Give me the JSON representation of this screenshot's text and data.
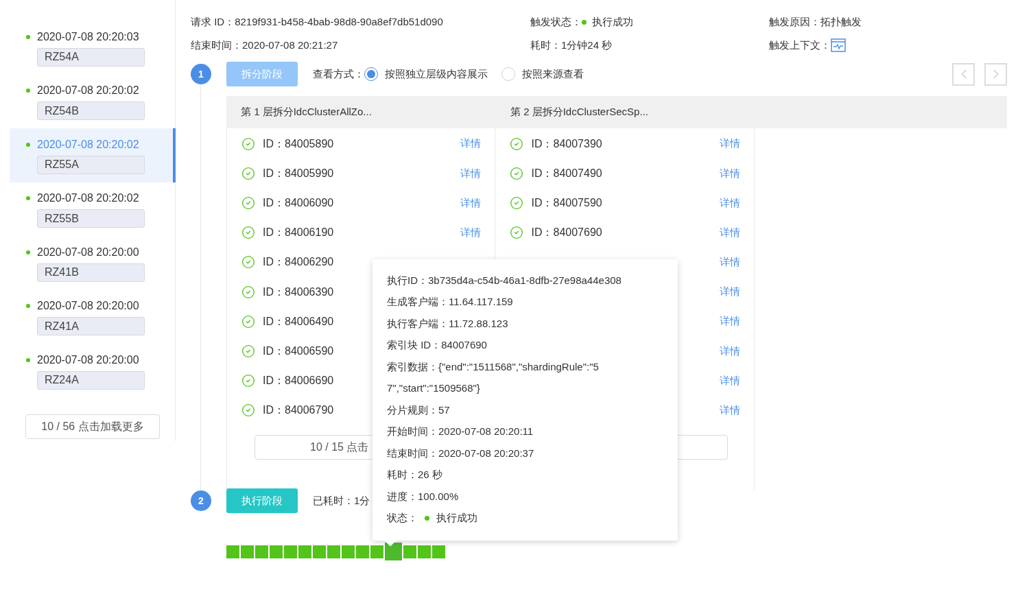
{
  "sidebar": {
    "items": [
      {
        "time": "2020-07-08 20:20:03",
        "tag": "RZ54A",
        "selected": false
      },
      {
        "time": "2020-07-08 20:20:02",
        "tag": "RZ54B",
        "selected": false
      },
      {
        "time": "2020-07-08 20:20:02",
        "tag": "RZ55A",
        "selected": true
      },
      {
        "time": "2020-07-08 20:20:02",
        "tag": "RZ55B",
        "selected": false
      },
      {
        "time": "2020-07-08 20:20:00",
        "tag": "RZ41B",
        "selected": false
      },
      {
        "time": "2020-07-08 20:20:00",
        "tag": "RZ41A",
        "selected": false
      },
      {
        "time": "2020-07-08 20:20:00",
        "tag": "RZ24A",
        "selected": false
      }
    ],
    "load_more": "10 / 56 点击加载更多"
  },
  "summary": [
    {
      "kind": "text",
      "label": "请求 ID：",
      "value": "8219f931-b458-4bab-98d8-90a8ef7db51d090"
    },
    {
      "kind": "status",
      "label": "触发状态：",
      "value": "执行成功"
    },
    {
      "kind": "text",
      "label": "触发原因：",
      "value": "拓扑触发"
    },
    {
      "kind": "text",
      "label": "结束时间：",
      "value": "2020-07-08 20:21:27"
    },
    {
      "kind": "text",
      "label": "耗时：",
      "value": "1分钟24 秒"
    },
    {
      "kind": "icon",
      "label": "触发上下文："
    }
  ],
  "stage1": {
    "number": "1",
    "button": "拆分阶段",
    "view_label": "查看方式：",
    "view_options": [
      {
        "label": "按照独立层级内容展示",
        "selected": true
      },
      {
        "label": "按照来源查看",
        "selected": false
      }
    ],
    "columns": [
      {
        "title": "第 1 层拆分IdcClusterAllZo...",
        "items": [
          {
            "id": "ID：84005890",
            "link": "详情"
          },
          {
            "id": "ID：84005990",
            "link": "详情"
          },
          {
            "id": "ID：84006090",
            "link": "详情"
          },
          {
            "id": "ID：84006190",
            "link": "详情"
          },
          {
            "id": "ID：84006290"
          },
          {
            "id": "ID：84006390"
          },
          {
            "id": "ID：84006490"
          },
          {
            "id": "ID：84006590"
          },
          {
            "id": "ID：84006690"
          },
          {
            "id": "ID：84006790"
          }
        ]
      },
      {
        "title": "第 2 层拆分IdcClusterSecSp...",
        "items": [
          {
            "id": "ID：84007390",
            "link": "详情"
          },
          {
            "id": "ID：84007490",
            "link": "详情"
          },
          {
            "id": "ID：84007590",
            "link": "详情"
          },
          {
            "id": "ID：84007690",
            "link": "详情"
          },
          {
            "link": "详情"
          },
          {
            "link": "详情"
          },
          {
            "link": "详情"
          },
          {
            "link": "详情"
          },
          {
            "link": "详情"
          },
          {
            "link": "详情"
          }
        ]
      }
    ],
    "load_more": "10 / 15 点击"
  },
  "stage2": {
    "number": "2",
    "button": "执行阶段",
    "elapsed": "已耗时：1分",
    "blocks": [
      {
        "selected": false
      },
      {
        "selected": false
      },
      {
        "selected": false
      },
      {
        "selected": false
      },
      {
        "selected": false
      },
      {
        "selected": false
      },
      {
        "selected": false
      },
      {
        "selected": false
      },
      {
        "selected": false
      },
      {
        "selected": false
      },
      {
        "selected": false
      },
      {
        "selected": true
      },
      {
        "selected": false
      },
      {
        "selected": false
      },
      {
        "selected": false
      }
    ]
  },
  "tooltip": {
    "lines": [
      "执行ID：3b735d4a-c54b-46a1-8dfb-27e98a44e308",
      "生成客户端：11.64.117.159",
      "执行客户端：11.72.88.123",
      "索引块 ID：84007690",
      "索引数据：{\"end\":\"1511568\",\"shardingRule\":\"5",
      "7\",\"start\":\"1509568\"}",
      "分片规则：57",
      "开始时间：2020-07-08 20:20:11",
      "结束时间：2020-07-08 20:20:37",
      "耗时：26 秒",
      "进度：100.00%"
    ],
    "status": {
      "label": "状态：",
      "value": "执行成功"
    }
  }
}
